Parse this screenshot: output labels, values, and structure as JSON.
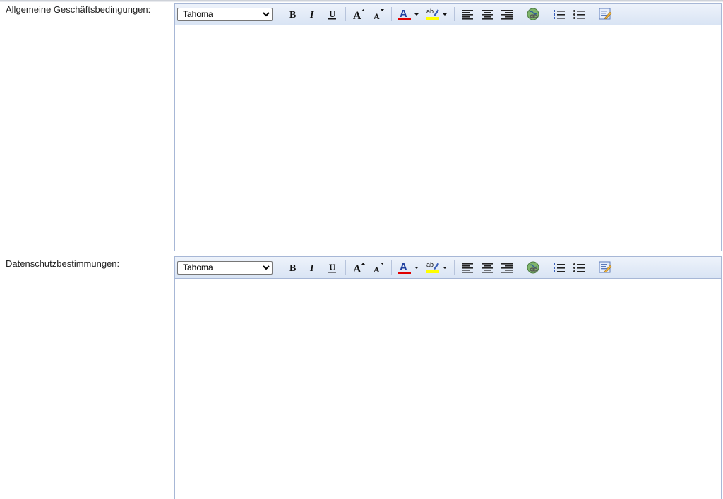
{
  "editors": [
    {
      "label": "Allgemeine Geschäftsbedingungen:",
      "font_selected": "Tahoma",
      "font_options": [
        "Tahoma"
      ],
      "content": ""
    },
    {
      "label": "Datenschutzbestimmungen:",
      "font_selected": "Tahoma",
      "font_options": [
        "Tahoma"
      ],
      "content": ""
    }
  ],
  "toolbar": {
    "bold_glyph": "B",
    "italic_glyph": "I",
    "underline_glyph": "U",
    "grow_glyph": "A",
    "shrink_glyph": "A",
    "fore_color_glyph": "A",
    "highlight_glyph": "ab",
    "icons": [
      "bold-icon",
      "italic-icon",
      "underline-icon",
      "font-size-increase-icon",
      "font-size-decrease-icon",
      "font-color-icon",
      "highlight-color-icon",
      "align-left-icon",
      "align-center-icon",
      "align-right-icon",
      "insert-link-icon",
      "ordered-list-icon",
      "unordered-list-icon",
      "html-source-icon"
    ]
  },
  "colors": {
    "fore_color_bar": "#e00000",
    "highlight_bar": "#ffff00",
    "toolbar_border": "#a7b7d6"
  }
}
